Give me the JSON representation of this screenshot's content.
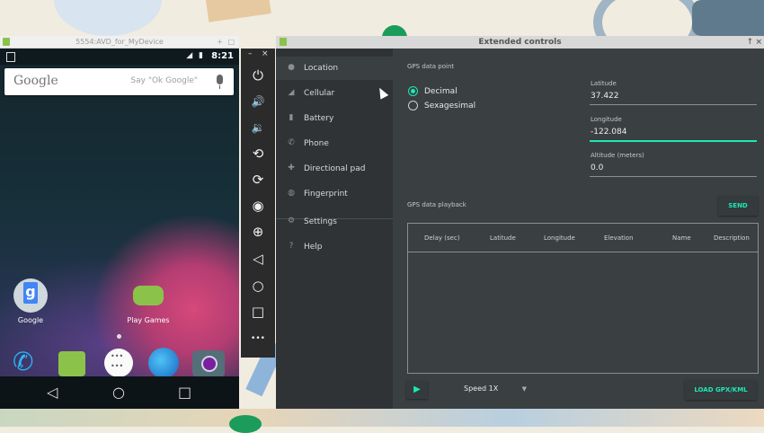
{
  "emulator": {
    "title": "5554:AVD_for_MyDevice",
    "window_controls": [
      "+",
      "□"
    ],
    "status": {
      "time": "8:21",
      "icons": "◢ ▮"
    },
    "search": {
      "logo": "Google",
      "hint": "Say \"Ok Google\""
    },
    "apps": [
      {
        "label": "Google",
        "icon": "google-app-icon"
      },
      {
        "label": "Play Games",
        "icon": "play-games-icon"
      }
    ],
    "dock": [
      "phone-icon",
      "messenger-icon",
      "app-drawer-icon",
      "browser-icon",
      "camera-icon"
    ],
    "nav": {
      "back": "◁",
      "home": "○",
      "recents": "□"
    }
  },
  "toolbar": {
    "window_controls": [
      "–",
      "×"
    ],
    "buttons": [
      {
        "name": "power",
        "glyph": "⏻"
      },
      {
        "name": "volume-up",
        "glyph": "🔊"
      },
      {
        "name": "volume-down",
        "glyph": "🔉"
      },
      {
        "name": "rotate-left",
        "glyph": "⟲"
      },
      {
        "name": "rotate-right",
        "glyph": "⟳"
      },
      {
        "name": "screenshot",
        "glyph": "◉"
      },
      {
        "name": "zoom",
        "glyph": "⊕"
      },
      {
        "name": "back",
        "glyph": "◁"
      },
      {
        "name": "home",
        "glyph": "○"
      },
      {
        "name": "overview",
        "glyph": "□"
      },
      {
        "name": "more",
        "glyph": "•••"
      }
    ]
  },
  "extended": {
    "title": "Extended controls",
    "window_controls": [
      "↑",
      "×"
    ],
    "nav": [
      {
        "label": "Location",
        "icon": "●"
      },
      {
        "label": "Cellular",
        "icon": "◢"
      },
      {
        "label": "Battery",
        "icon": "▮"
      },
      {
        "label": "Phone",
        "icon": "✆"
      },
      {
        "label": "Directional pad",
        "icon": "✚"
      },
      {
        "label": "Fingerprint",
        "icon": "◍"
      },
      {
        "label": "Settings",
        "icon": "⚙"
      },
      {
        "label": "Help",
        "icon": "?"
      }
    ],
    "gps_point_label": "GPS data point",
    "format_options": [
      {
        "label": "Decimal",
        "selected": true
      },
      {
        "label": "Sexagesimal",
        "selected": false
      }
    ],
    "fields": {
      "latitude": {
        "label": "Latitude",
        "value": "37.422"
      },
      "longitude": {
        "label": "Longitude",
        "value": "-122.084"
      },
      "altitude": {
        "label": "Altitude (meters)",
        "value": "0.0"
      }
    },
    "send_label": "SEND",
    "playback_label": "GPS data playback",
    "table_headers": [
      "Delay (sec)",
      "Latitude",
      "Longitude",
      "Elevation",
      "Name",
      "Description"
    ],
    "play_glyph": "▶",
    "speed": "Speed 1X",
    "load_label": "LOAD GPX/KML",
    "accent_color": "#1de9b6"
  }
}
